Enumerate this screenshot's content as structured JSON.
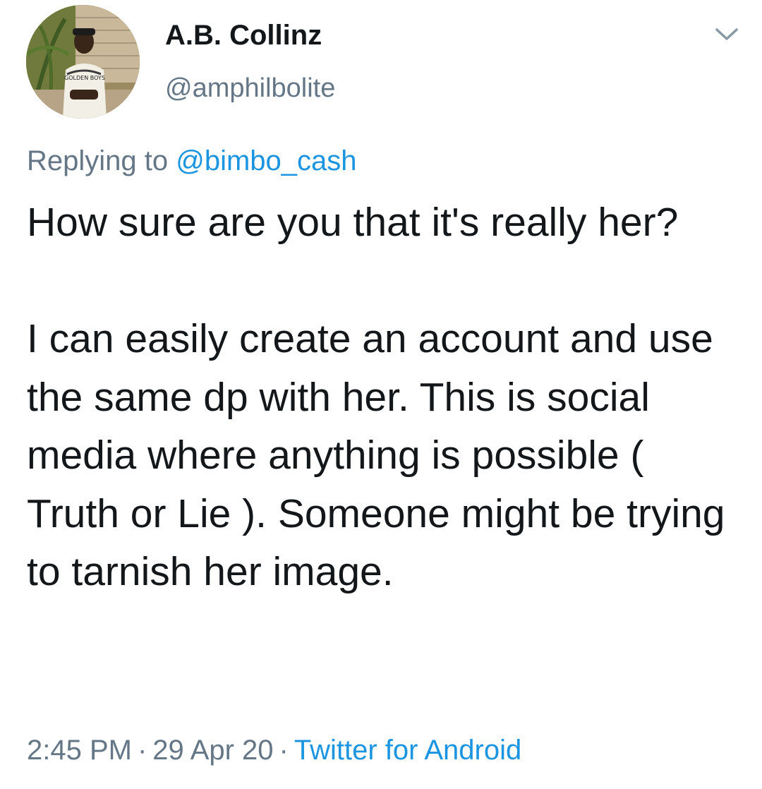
{
  "tweet": {
    "author": {
      "display_name": "A.B. Collinz",
      "handle": "@amphilbolite",
      "avatar_shirt_text": "GOLDEN BOYS"
    },
    "menu_icon": "chevron-down-icon",
    "replying_to": {
      "prefix": "Replying to",
      "user": "@bimbo_cash"
    },
    "text": "How sure are you that it's really her?\n\nI can easily create an account and use the same dp with her. This is social media where anything is possible ( Truth or Lie ). Someone might be trying to tarnish her image.",
    "time": "2:45 PM",
    "date": "29 Apr 20",
    "separator": "·",
    "source": "Twitter for Android"
  },
  "colors": {
    "text_primary": "#14171a",
    "text_secondary": "#657786",
    "link": "#1b95e0"
  }
}
